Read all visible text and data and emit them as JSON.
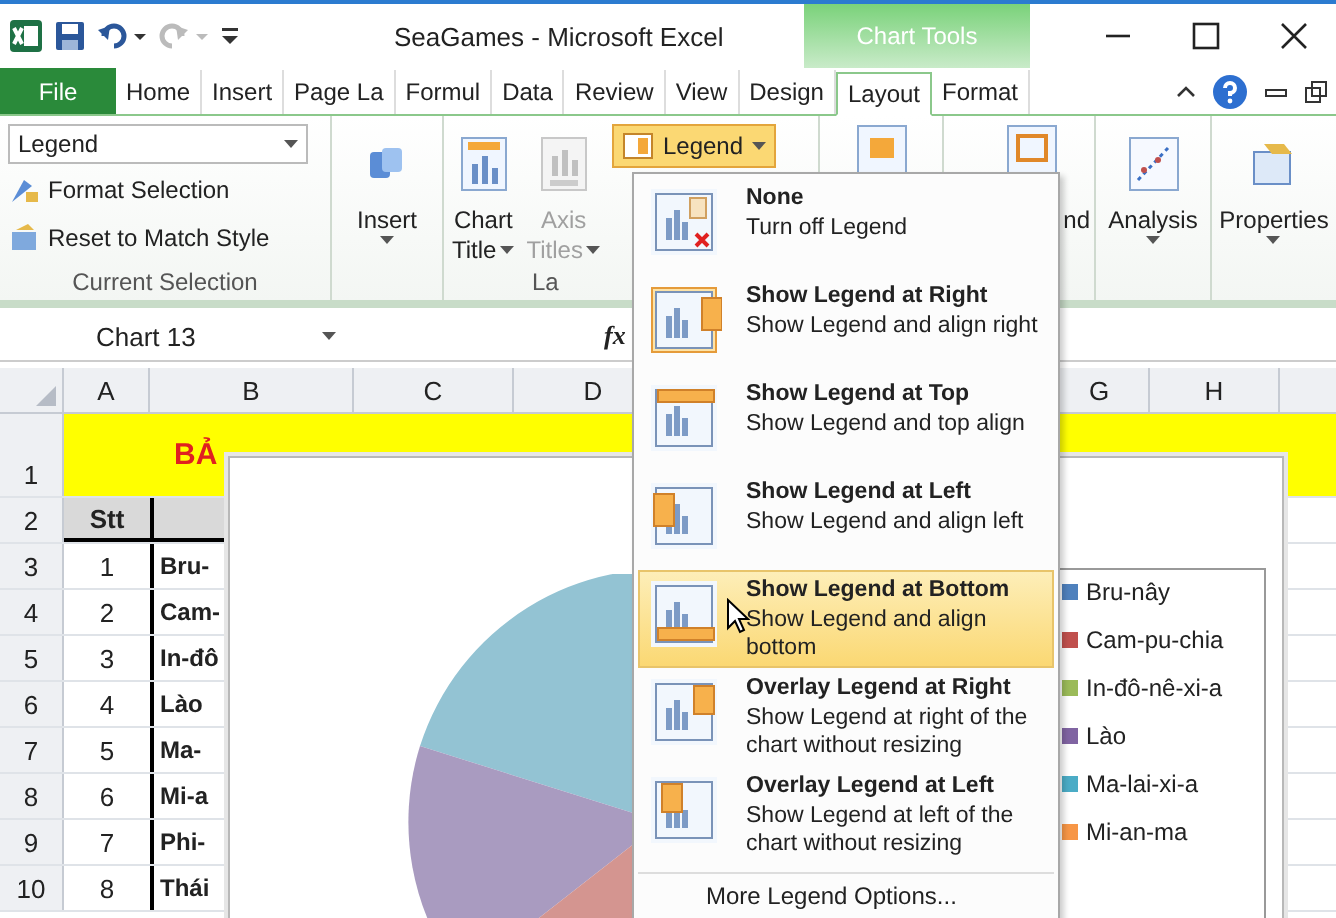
{
  "window": {
    "title": "SeaGames  -  Microsoft Excel",
    "context_tab": "Chart Tools"
  },
  "tabs": [
    {
      "label": "File",
      "kind": "file",
      "selected": false
    },
    {
      "label": "Home",
      "kind": "tab",
      "selected": false
    },
    {
      "label": "Insert",
      "kind": "tab",
      "selected": false
    },
    {
      "label": "Page La",
      "kind": "tab",
      "selected": false
    },
    {
      "label": "Formul",
      "kind": "tab",
      "selected": false
    },
    {
      "label": "Data",
      "kind": "tab",
      "selected": false
    },
    {
      "label": "Review",
      "kind": "tab",
      "selected": false
    },
    {
      "label": "View",
      "kind": "tab",
      "selected": false
    },
    {
      "label": "Design",
      "kind": "tab",
      "selected": false
    },
    {
      "label": "Layout",
      "kind": "tab",
      "selected": true
    },
    {
      "label": "Format",
      "kind": "tab",
      "selected": false
    }
  ],
  "ribbon": {
    "selection_dropdown": "Legend",
    "format_selection": "Format Selection",
    "reset_style": "Reset to Match Style",
    "current_selection_label": "Current Selection",
    "insert": "Insert",
    "chart_title": [
      "Chart",
      "Title"
    ],
    "axis_titles": {
      "label": [
        "Axis",
        "Titles"
      ],
      "disabled": true
    },
    "legend_button": {
      "label": "Legend",
      "expanded": true
    },
    "labels_group": "La",
    "hidden_button": "nd",
    "analysis": "Analysis",
    "properties": "Properties"
  },
  "formula_bar": {
    "name_box": "Chart 13",
    "fx": "fx"
  },
  "columns": [
    "A",
    "B",
    "C",
    "D",
    "G",
    "H"
  ],
  "title_row": {
    "number": "1",
    "text": "BẢ"
  },
  "header_row": {
    "number": "2",
    "stt": "Stt"
  },
  "rows": [
    {
      "number": "3",
      "stt": "1",
      "name": "Bru-"
    },
    {
      "number": "4",
      "stt": "2",
      "name": "Cam-"
    },
    {
      "number": "5",
      "stt": "3",
      "name": "In-đô"
    },
    {
      "number": "6",
      "stt": "4",
      "name": "Lào"
    },
    {
      "number": "7",
      "stt": "5",
      "name": "Ma-"
    },
    {
      "number": "8",
      "stt": "6",
      "name": "Mi-a"
    },
    {
      "number": "9",
      "stt": "7",
      "name": "Phi-"
    },
    {
      "number": "10",
      "stt": "8",
      "name": "Thái"
    }
  ],
  "legend_entries": [
    {
      "label": "Bru-nây",
      "color": "#4f81bd"
    },
    {
      "label": "Cam-pu-chia",
      "color": "#c0504d"
    },
    {
      "label": "In-đô-nê-xi-a",
      "color": "#9bbb59"
    },
    {
      "label": "Lào",
      "color": "#8064a2"
    },
    {
      "label": "Ma-lai-xi-a",
      "color": "#4bacc6"
    },
    {
      "label": "Mi-an-ma",
      "color": "#f79646"
    }
  ],
  "legend_menu": [
    {
      "kind": "none",
      "title": "None",
      "description": "Turn off Legend",
      "selected": false,
      "highlighted": false
    },
    {
      "kind": "right",
      "title": "Show Legend at Right",
      "description": "Show Legend and align right",
      "selected": true,
      "highlighted": false
    },
    {
      "kind": "top",
      "title": "Show Legend at Top",
      "description": "Show Legend and top align",
      "selected": false,
      "highlighted": false
    },
    {
      "kind": "left",
      "title": "Show Legend at Left",
      "description": "Show Legend and align left",
      "selected": false,
      "highlighted": false
    },
    {
      "kind": "bottom",
      "title": "Show Legend at Bottom",
      "description": "Show Legend and align bottom",
      "selected": false,
      "highlighted": true
    },
    {
      "kind": "overlay_right",
      "title": "Overlay Legend at Right",
      "description": "Show Legend at right of the chart without resizing",
      "selected": false,
      "highlighted": false
    },
    {
      "kind": "overlay_left",
      "title": "Overlay Legend at Left",
      "description": "Show Legend at left of the chart without resizing",
      "selected": false,
      "highlighted": false
    }
  ],
  "more_options": "More Legend Options..."
}
